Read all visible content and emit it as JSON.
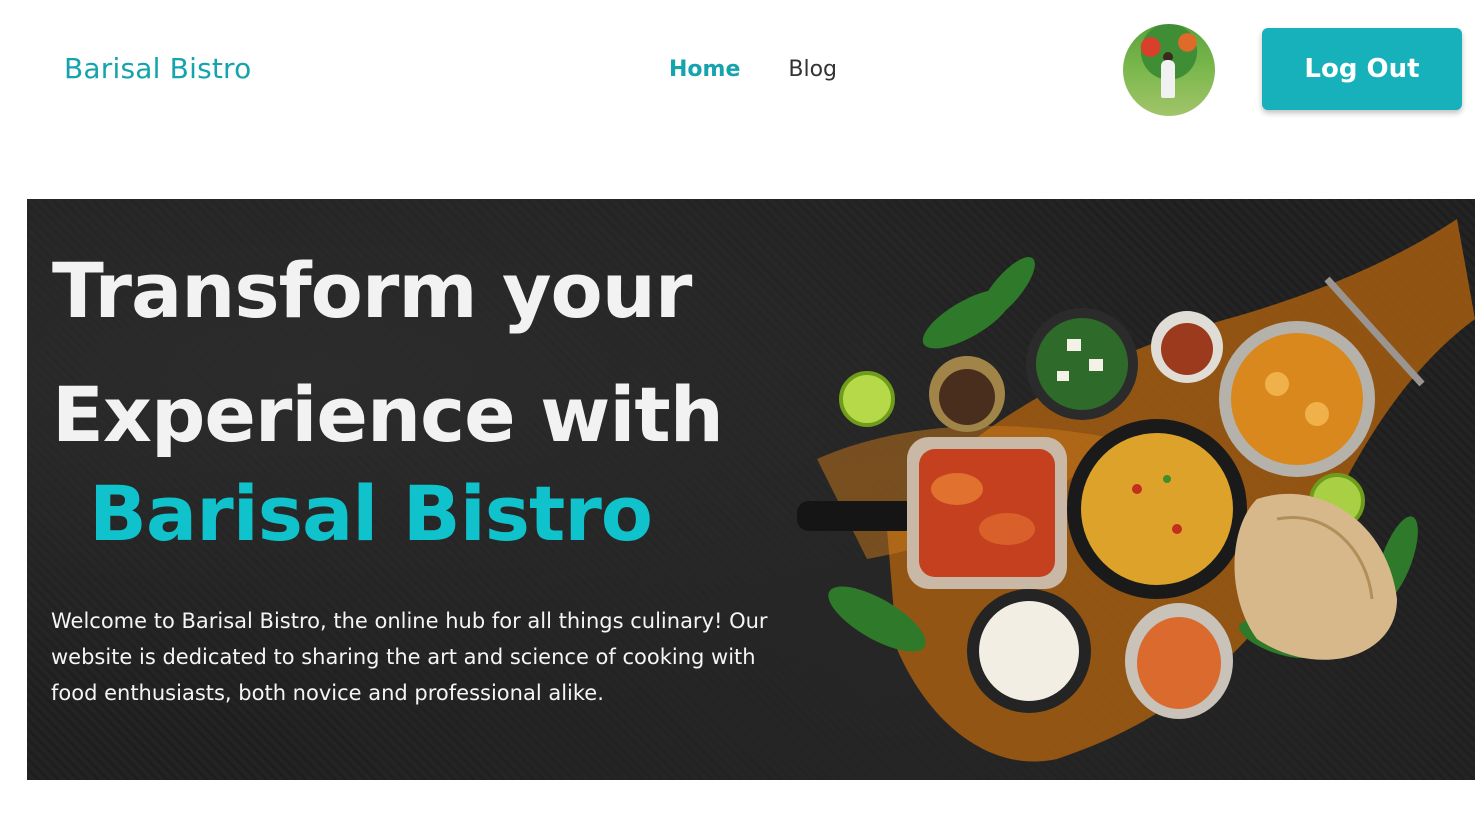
{
  "nav": {
    "brand": "Barisal Bistro",
    "links": [
      {
        "label": "Home",
        "active": true
      },
      {
        "label": "Blog",
        "active": false
      }
    ],
    "logout_label": "Log Out"
  },
  "hero": {
    "title_line1": "Transform your",
    "title_line2": "Experience with",
    "brand": "Barisal Bistro",
    "description": "Welcome to Barisal Bistro, the online hub for all things culinary! Our website is dedicated to sharing the art and science of cooking with food enthusiasts, both novice and professional alike."
  },
  "colors": {
    "accent": "#15a3ad",
    "button": "#16b1bb",
    "hero_brand": "#0fc2cc"
  }
}
